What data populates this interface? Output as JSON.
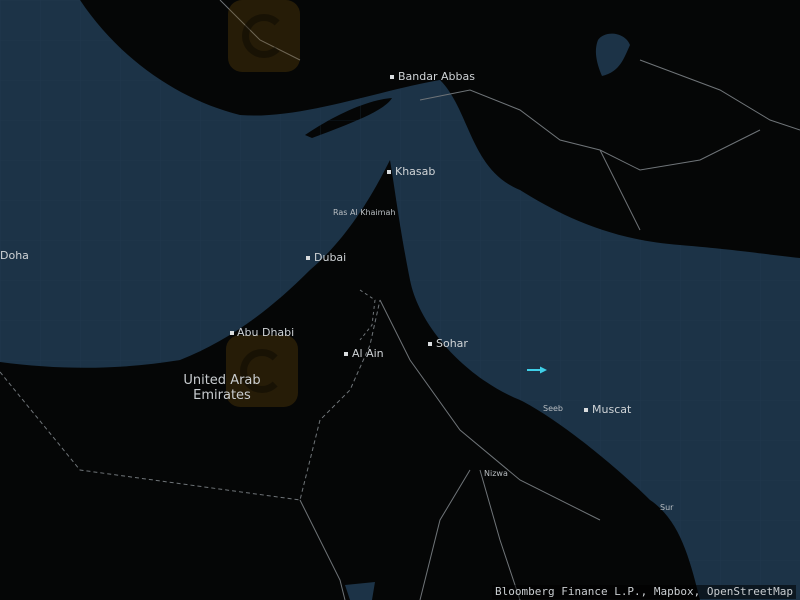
{
  "map": {
    "cities": [
      {
        "name": "Bandar Abbas"
      },
      {
        "name": "Khasab"
      },
      {
        "name": "Ras Al Khaimah"
      },
      {
        "name": "Dubai"
      },
      {
        "name": "Doha"
      },
      {
        "name": "Abu Dhabi"
      },
      {
        "name": "Al Ain"
      },
      {
        "name": "Sohar"
      },
      {
        "name": "Seeb"
      },
      {
        "name": "Muscat"
      },
      {
        "name": "Nizwa"
      },
      {
        "name": "Sur"
      }
    ],
    "country_label": "United Arab\nEmirates",
    "attribution": "Bloomberg Finance L.P., Mapbox, OpenStreetMap",
    "colors": {
      "water": "#1c3347",
      "land": "#050606",
      "border": "#6f7478",
      "marker": "#3fd0e8"
    }
  }
}
